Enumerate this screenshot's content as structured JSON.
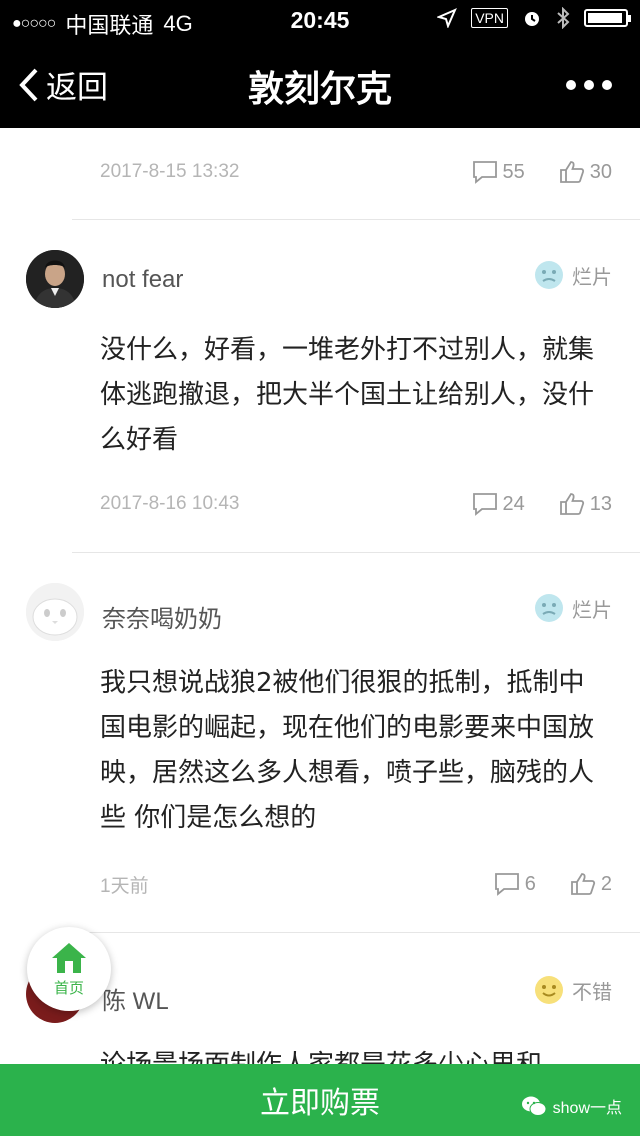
{
  "status_bar": {
    "carrier": "中国联通",
    "network": "4G",
    "time": "20:45",
    "vpn": "VPN",
    "battery_level": 0.95
  },
  "nav": {
    "back_label": "返回",
    "title": "敦刻尔克"
  },
  "prev_comment": {
    "date": "2017-8-15 13:32",
    "comment_count": "55",
    "like_count": "30"
  },
  "comments": [
    {
      "username": "not fear",
      "rating": "烂片",
      "text": "没什么，好看，一堆老外打不过别人，就集体逃跑撤退，把大半个国土让给别人，没什么好看",
      "date": "2017-8-16 10:43",
      "comment_count": "24",
      "like_count": "13"
    },
    {
      "username": "奈奈喝奶奶",
      "rating": "烂片",
      "text": "我只想说战狼2被他们很狠的抵制，抵制中国电影的崛起，现在他们的电影要来中国放映，居然这么多人想看，喷子些，脑残的人些 你们是怎么想的",
      "date": "1天前",
      "comment_count": "6",
      "like_count": "2"
    },
    {
      "username": "陈 WL",
      "rating": "不错",
      "text": "论场景场面制作人家都是花多少心思和"
    }
  ],
  "home_button": {
    "label": "首页"
  },
  "buy_bar": {
    "label": "立即购票"
  },
  "watermark": "show一点",
  "colors": {
    "accent_green": "#2bb24c",
    "navbar": "#000000"
  }
}
